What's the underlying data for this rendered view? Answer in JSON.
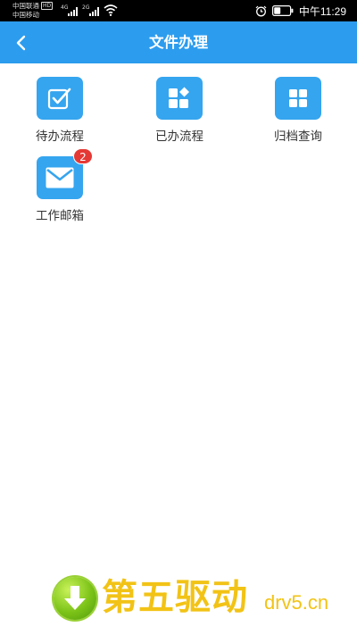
{
  "status_bar": {
    "carrier_1": "中国联通",
    "carrier_1_badge": "HD",
    "carrier_2": "中国移动",
    "signal_1_tag": "4G",
    "signal_2_tag": "2G",
    "time": "中午11:29",
    "icons": [
      "signal-icon",
      "wifi-icon",
      "alarm-clock-icon",
      "battery-icon"
    ]
  },
  "app_bar": {
    "back_icon": "back-arrow-icon",
    "title": "文件办理",
    "color": "#2c9cee"
  },
  "grid": {
    "items": [
      {
        "label": "待办流程",
        "icon": "pending-checklist-icon"
      },
      {
        "label": "已办流程",
        "icon": "done-tiles-icon"
      },
      {
        "label": "归档查询",
        "icon": "archive-grid-icon"
      },
      {
        "label": "工作邮箱",
        "icon": "mail-envelope-icon",
        "badge": "2"
      }
    ],
    "icon_color": "#35a5ef",
    "badge_color": "#e53935"
  },
  "watermark": {
    "logo": "download-arrow-icon",
    "text_cn": "第五驱动",
    "text_en": "drv5.cn",
    "color": "#f2c316"
  }
}
